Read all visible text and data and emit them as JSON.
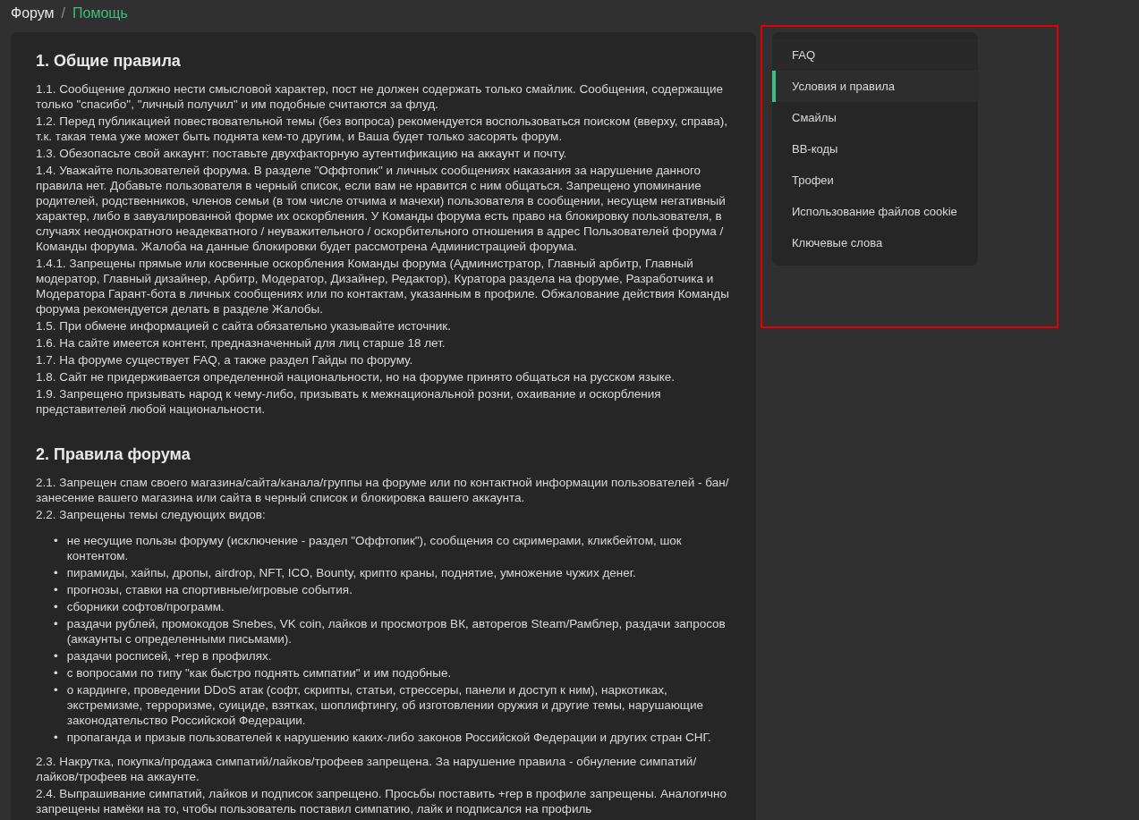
{
  "breadcrumb_separator": "/",
  "breadcrumb": [
    {
      "label": "Форум",
      "selected": false
    },
    {
      "label": "Помощь",
      "selected": true
    }
  ],
  "sections": [
    {
      "title": "1. Общие правила",
      "blocks": [
        {
          "kind": "paragraph",
          "text": "1.1. Сообщение должно нести смысловой характер, пост не должен содержать только смайлик. Сообщения, содержащие только \"спасибо\", \"личный получил\" и им подобные считаются за флуд."
        },
        {
          "kind": "paragraph",
          "text": "1.2. Перед публикацией повествовательной темы (без вопроса) рекомендуется воспользоваться поиском (вверху, справа), т.к. такая тема уже может быть поднята кем-то другим, и Ваша будет только засорять форум."
        },
        {
          "kind": "paragraph",
          "text": "1.3. Обезопасьте свой аккаунт: поставьте двухфакторную аутентификацию на аккаунт и почту."
        },
        {
          "kind": "paragraph",
          "text": "1.4. Уважайте пользователей форума. В разделе \"Оффтопик\" и личных сообщениях наказания за нарушение данного правила нет. Добавьте пользователя в черный список, если вам не нравится с ним общаться. Запрещено упоминание родителей, родственников, членов семьи (в том числе отчима и мачехи) пользователя в сообщении, несущем негативный характер, либо в завуалированной форме их оскорбления. У Команды форума есть право на блокировку пользователя, в случаях неоднократного неадекватного / неуважительного / оскорбительного отношения в адрес Пользователей форума / Команды форума. Жалоба на данные блокировки будет рассмотрена Администрацией форума."
        },
        {
          "kind": "paragraph",
          "text": "1.4.1. Запрещены прямые или косвенные оскорбления Команды форума (Администратор, Главный арбитр, Главный модератор, Главный дизайнер, Арбитр, Модератор, Дизайнер, Редактор), Куратора раздела на форуме, Разработчика и Модератора Гарант-бота в личных сообщениях или по контактам, указанным в профиле. Обжалование действия Команды форума рекомендуется делать в разделе Жалобы."
        },
        {
          "kind": "paragraph",
          "text": "1.5. При обмене информацией с сайта обязательно указывайте источник."
        },
        {
          "kind": "paragraph",
          "text": "1.6. На сайте имеется контент, предназначенный для лиц старше 18 лет."
        },
        {
          "kind": "paragraph",
          "text": "1.7. На форуме существует FAQ, а также раздел Гайды по форуму."
        },
        {
          "kind": "paragraph",
          "text": "1.8. Сайт не придерживается определенной национальности, но на форуме принято общаться на русском языке."
        },
        {
          "kind": "paragraph",
          "text": "1.9. Запрещено призывать народ к чему-либо, призывать к межнациональной розни, охаивание и оскорбления представителей любой национальности."
        }
      ]
    },
    {
      "title": "2. Правила форума",
      "blocks": [
        {
          "kind": "paragraph",
          "text": "2.1. Запрещен спам своего магазина/сайта/канала/группы на форуме или по контактной информации пользователей - бан/занесение вашего магазина или сайта в черный список и блокировка вашего аккаунта."
        },
        {
          "kind": "paragraph",
          "text": "2.2. Запрещены темы следующих видов:"
        },
        {
          "kind": "list",
          "marker": "•",
          "items": [
            "не несущие пользы форуму (исключение - раздел \"Оффтопик\"), сообщения со скримерами, кликбейтом, шок контентом.",
            "пирамиды, хайпы, дропы, airdrop, NFT, ICO, Bounty, крипто краны, поднятие, умножение чужих денег.",
            "прогнозы, ставки на спортивные/игровые события.",
            "сборники софтов/программ.",
            "раздачи рублей, промокодов Snebes, VK coin, лайков и просмотров ВК, авторегов Steam/Рамблер, раздачи запросов (аккаунты с определенными письмами).",
            "раздачи росписей, +rep в профилях.",
            "с вопросами по типу \"как быстро поднять симпатии\" и им подобные.",
            "о кардинге, проведении DDoS атак (софт, скрипты, статьи, стрессеры, панели и доступ к ним), наркотиках, экстремизме, терроризме, суициде, взятках, шоплифтингу, об изготовлении оружия и другие темы, нарушающие законодательство Российской Федерации.",
            "пропаганда и призыв пользователей к нарушению каких-либо законов Российской Федерации и других стран СНГ."
          ]
        },
        {
          "kind": "paragraph",
          "text": "2.3. Накрутка, покупка/продажа симпатий/лайков/трофеев запрещена. За нарушение правила - обнуление симпатий/ лайков/трофеев на аккаунте."
        },
        {
          "kind": "paragraph",
          "text": "2.4. Выпрашивание симпатий, лайков и подписок запрещено. Просьбы поставить +rep в профиле запрещены. Аналогично запрещены намёки на то, чтобы пользователь поставил симпатию, лайк и подписался на профиль"
        }
      ]
    }
  ],
  "nav": [
    {
      "label": "FAQ",
      "selected": false
    },
    {
      "label": "Условия и правила",
      "selected": true
    },
    {
      "label": "Смайлы",
      "selected": false
    },
    {
      "label": "BB-коды",
      "selected": false
    },
    {
      "label": "Трофеи",
      "selected": false
    },
    {
      "label": "Использование файлов cookie",
      "selected": false
    },
    {
      "label": "Ключевые слова",
      "selected": false
    }
  ]
}
